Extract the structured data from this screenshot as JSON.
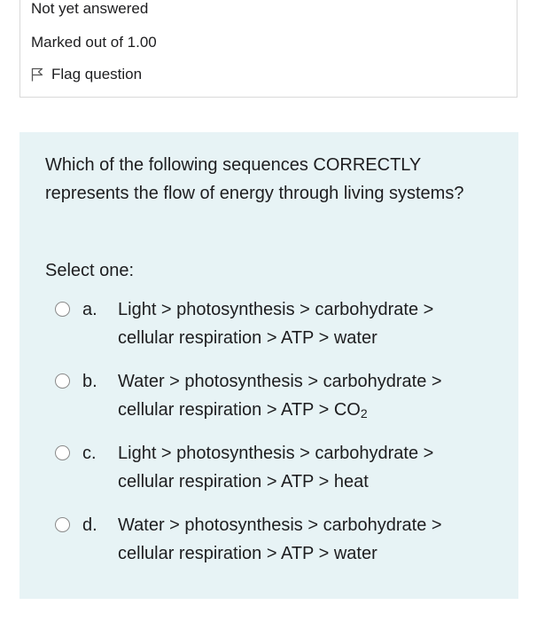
{
  "question_info": {
    "state": "Not yet answered",
    "grade": "Marked out of 1.00",
    "flag_label": "Flag question"
  },
  "question": {
    "text": "Which of the following sequences CORRECTLY represents the flow of energy through living systems?",
    "prompt": "Select one:",
    "options": [
      {
        "letter": "a.",
        "line1": "Light > photosynthesis > carbohydrate >",
        "line2": "cellular respiration > ATP > water"
      },
      {
        "letter": "b.",
        "line1": "Water > photosynthesis > carbohydrate >",
        "line2_prefix": "cellular respiration > ATP > CO",
        "line2_sub": "2"
      },
      {
        "letter": "c.",
        "line1": "Light > photosynthesis > carbohydrate >",
        "line2": "cellular respiration > ATP > heat"
      },
      {
        "letter": "d.",
        "line1": "Water > photosynthesis > carbohydrate >",
        "line2": "cellular respiration > ATP > water"
      }
    ]
  },
  "colors": {
    "question_background": "#e7f3f5",
    "info_border": "#d9d9d9",
    "text": "#1d1d1f"
  },
  "icons": {
    "flag": "flag-icon"
  }
}
